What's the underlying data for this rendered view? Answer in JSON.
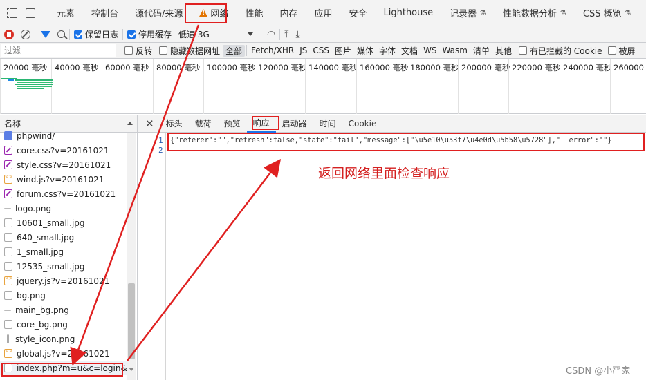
{
  "top_tabs": {
    "element_picker_icon": "cursor-select-icon",
    "device_icon": "device-toolbar-icon",
    "items": [
      "元素",
      "控制台",
      "源代码/来源",
      "网络",
      "性能",
      "内存",
      "应用",
      "安全",
      "Lighthouse",
      "记录器",
      "性能数据分析",
      "CSS 概览"
    ],
    "active": "网络"
  },
  "toolbar": {
    "preserve_log": "保留日志",
    "disable_cache": "停用缓存",
    "throttle": "低速 3G",
    "preserve_log_checked": true,
    "disable_cache_checked": true
  },
  "filter_bar": {
    "placeholder": "过滤",
    "invert": "反转",
    "hide_data_urls": "隐藏数据网址",
    "types": [
      "全部",
      "Fetch/XHR",
      "JS",
      "CSS",
      "图片",
      "媒体",
      "字体",
      "文档",
      "WS",
      "Wasm",
      "清单",
      "其他"
    ],
    "active_type": "全部",
    "blocked_cookies": "有已拦截的 Cookie",
    "blocked_requests": "被屏"
  },
  "overview": {
    "ticks": [
      "20000 毫秒",
      "40000 毫秒",
      "60000 毫秒",
      "80000 毫秒",
      "100000 毫秒",
      "120000 毫秒",
      "140000 毫秒",
      "160000 毫秒",
      "180000 毫秒",
      "200000 毫秒",
      "220000 毫秒",
      "240000 毫秒",
      "260000 毫秒"
    ]
  },
  "request_list": {
    "header": "名称",
    "items": [
      {
        "name": "phpwind/",
        "icon": "doc"
      },
      {
        "name": "core.css?v=20161021",
        "icon": "css"
      },
      {
        "name": "style.css?v=20161021",
        "icon": "css"
      },
      {
        "name": "wind.js?v=20161021",
        "icon": "js"
      },
      {
        "name": "forum.css?v=20161021",
        "icon": "css"
      },
      {
        "name": "logo.png",
        "icon": "line"
      },
      {
        "name": "10601_small.jpg",
        "icon": "img"
      },
      {
        "name": "640_small.jpg",
        "icon": "img"
      },
      {
        "name": "1_small.jpg",
        "icon": "img"
      },
      {
        "name": "12535_small.jpg",
        "icon": "img"
      },
      {
        "name": "jquery.js?v=20161021",
        "icon": "js"
      },
      {
        "name": "bg.png",
        "icon": "img"
      },
      {
        "name": "main_bg.png",
        "icon": "line"
      },
      {
        "name": "core_bg.png",
        "icon": "img"
      },
      {
        "name": "style_icon.png",
        "icon": "bar-v"
      },
      {
        "name": "global.js?v=20161021",
        "icon": "js"
      },
      {
        "name": "index.php?m=u&c=login&...",
        "icon": "img"
      }
    ]
  },
  "detail_tabs": {
    "items": [
      "标头",
      "载荷",
      "预览",
      "响应",
      "启动器",
      "时间",
      "Cookie"
    ],
    "active": "响应"
  },
  "response": {
    "line_numbers": [
      "1",
      "2"
    ],
    "line1": "{\"referer\":\"\",\"refresh\":false,\"state\":\"fail\",\"message\":[\"\\u5e10\\u53f7\\u4e0d\\u5b58\\u5728\"],\"__error\":\"\"}"
  },
  "annotation": {
    "text": "返回网络里面检查响应",
    "color": "#d42020"
  },
  "watermark": "CSDN @小严家"
}
